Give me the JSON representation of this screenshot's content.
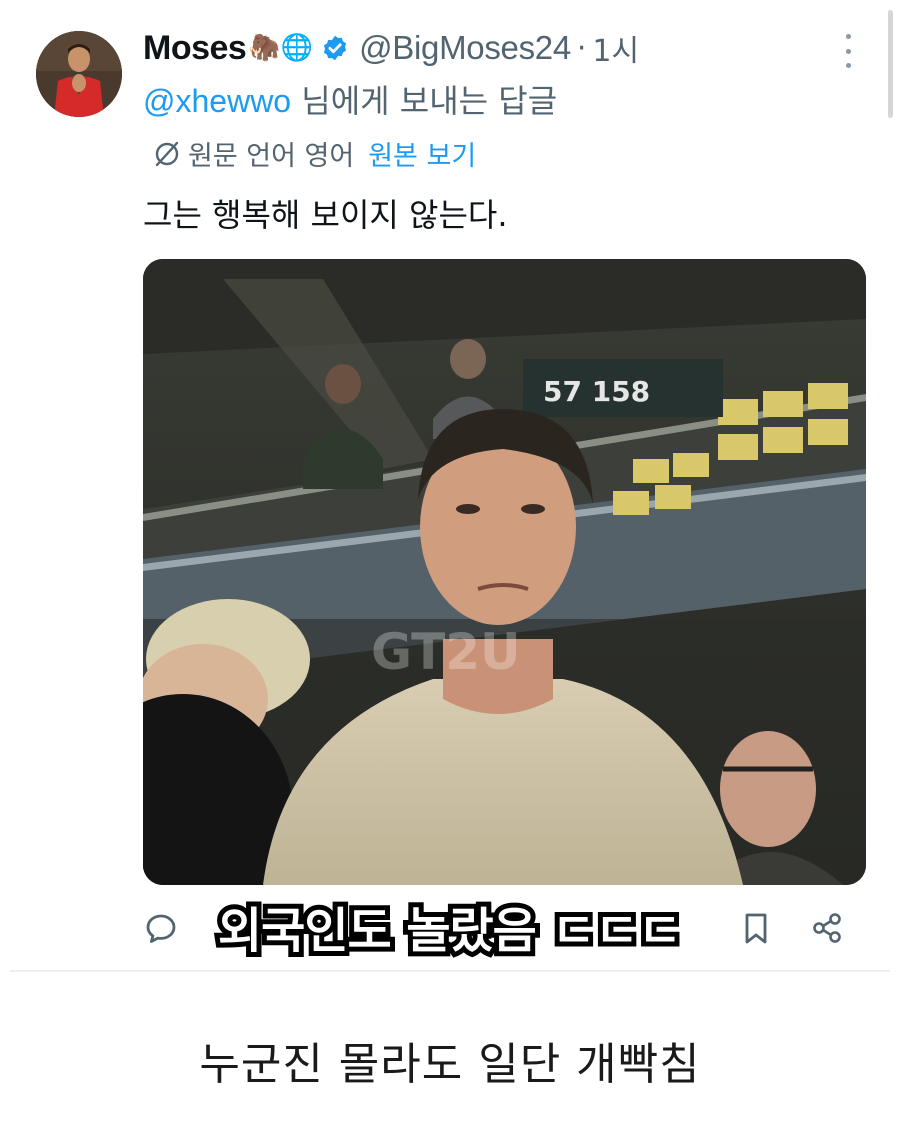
{
  "tweet": {
    "display_name": "Moses",
    "name_emojis": "🦣🌐",
    "handle": "@BigMoses24",
    "separator": "·",
    "time": "1시",
    "reply_to_handle": "@xhewwo",
    "reply_to_suffix": " 님에게 보내는 답글",
    "translation_label": "원문 언어 영어",
    "view_original_label": "원본 보기",
    "text": "그는 행복해 보이지 않는다.",
    "media_watermark": "GT2U",
    "media_sign_text": "57  158"
  },
  "overlay": {
    "caption": "외국인도 놀랐음 ㄷㄷㄷ"
  },
  "footer": {
    "caption": "누군진 몰라도 일단 개빡침"
  },
  "colors": {
    "link_blue": "#1d9bf0",
    "secondary_text": "#536471",
    "verified_blue": "#1d9bf0"
  },
  "icons": {
    "reply": "reply-icon",
    "bookmark": "bookmark-icon",
    "share": "share-icon",
    "more": "more-icon",
    "translate": "translate-icon",
    "verified": "verified-badge-icon"
  }
}
